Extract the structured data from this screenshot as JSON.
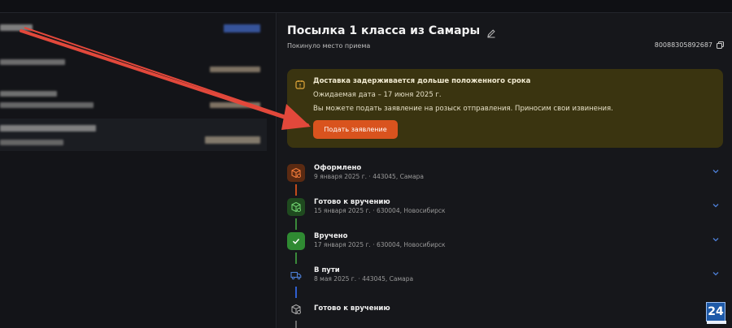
{
  "parcel": {
    "title": "Посылка 1 класса из Самары",
    "status_line": "Покинуло место приема",
    "tracking_number": "80088305892687"
  },
  "alert": {
    "title": "Доставка задерживается дольше положенного срока",
    "expected": "Ожидаемая дата – 17 июня 2025 г.",
    "message": "Вы можете подать заявление на розыск отправления. Приносим свои извинения.",
    "button": "Подать заявление"
  },
  "timeline": [
    {
      "title": "Оформлено",
      "sub": "9 января 2025 г. · 443045, Самара"
    },
    {
      "title": "Готово к вручению",
      "sub": "15 января 2025 г. · 630004, Новосибирск"
    },
    {
      "title": "Вручено",
      "sub": "17 января 2025 г. · 630004, Новосибирск"
    },
    {
      "title": "В пути",
      "sub": "8 мая 2025 г. · 443045, Самара"
    },
    {
      "title": "Готово к вручению",
      "sub": ""
    }
  ],
  "badge": {
    "label": "24"
  },
  "colors": {
    "alert_bg": "#3a3410",
    "accent_button": "#d9531e",
    "annotation_arrow": "#e2483b",
    "chevron": "#4d7fd6"
  },
  "icons": {
    "edit": "pencil-icon",
    "copy": "copy-icon",
    "alert": "calendar-alert-icon",
    "chevron": "chevron-down-icon"
  }
}
